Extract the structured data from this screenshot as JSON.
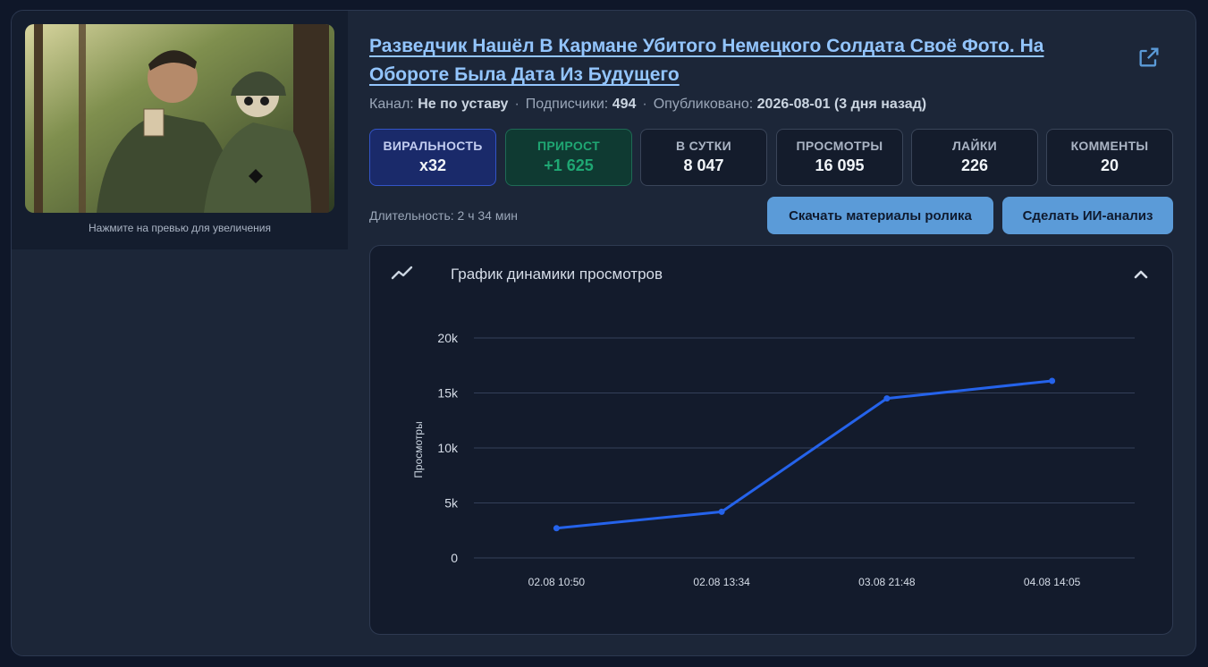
{
  "thumbnail": {
    "hint": "Нажмите на превью для увеличения"
  },
  "video": {
    "title": "Разведчик Нашёл В Кармане Убитого Немецкого Солдата Своё Фото. На Обороте Была Дата Из Будущего",
    "channel_label": "Канал:",
    "channel": "Не по уставу",
    "subscribers_label": "Подписчики:",
    "subscribers": "494",
    "published_label": "Опубликовано:",
    "published": "2026-08-01 (3 дня назад)",
    "duration": "Длительность: 2 ч 34 мин"
  },
  "stats": [
    {
      "label": "ВИРАЛЬНОСТЬ",
      "value": "x32"
    },
    {
      "label": "ПРИРОСТ",
      "value": "+1 625"
    },
    {
      "label": "В СУТКИ",
      "value": "8 047"
    },
    {
      "label": "ПРОСМОТРЫ",
      "value": "16 095"
    },
    {
      "label": "ЛАЙКИ",
      "value": "226"
    },
    {
      "label": "КОММЕНТЫ",
      "value": "20"
    }
  ],
  "buttons": {
    "download": "Скачать материалы ролика",
    "ai_analysis": "Сделать ИИ-анализ"
  },
  "panel": {
    "title": "График динамики просмотров"
  },
  "colors": {
    "line": "#2563eb",
    "accent": "#93c5fd",
    "button": "#5b9bd8"
  },
  "icons": {
    "external": "external-link-icon",
    "chart": "trend-line-icon",
    "collapse": "chevron-up-icon"
  },
  "chart_data": {
    "type": "line",
    "ylabel": "Просмотры",
    "xlabel": "",
    "categories": [
      "02.08 10:50",
      "02.08 13:34",
      "03.08 21:48",
      "04.08 14:05"
    ],
    "values": [
      2700,
      4200,
      14500,
      16100
    ],
    "ylim": [
      0,
      20000
    ],
    "yticks": [
      "0",
      "5k",
      "10k",
      "15k",
      "20k"
    ],
    "grid": true
  }
}
